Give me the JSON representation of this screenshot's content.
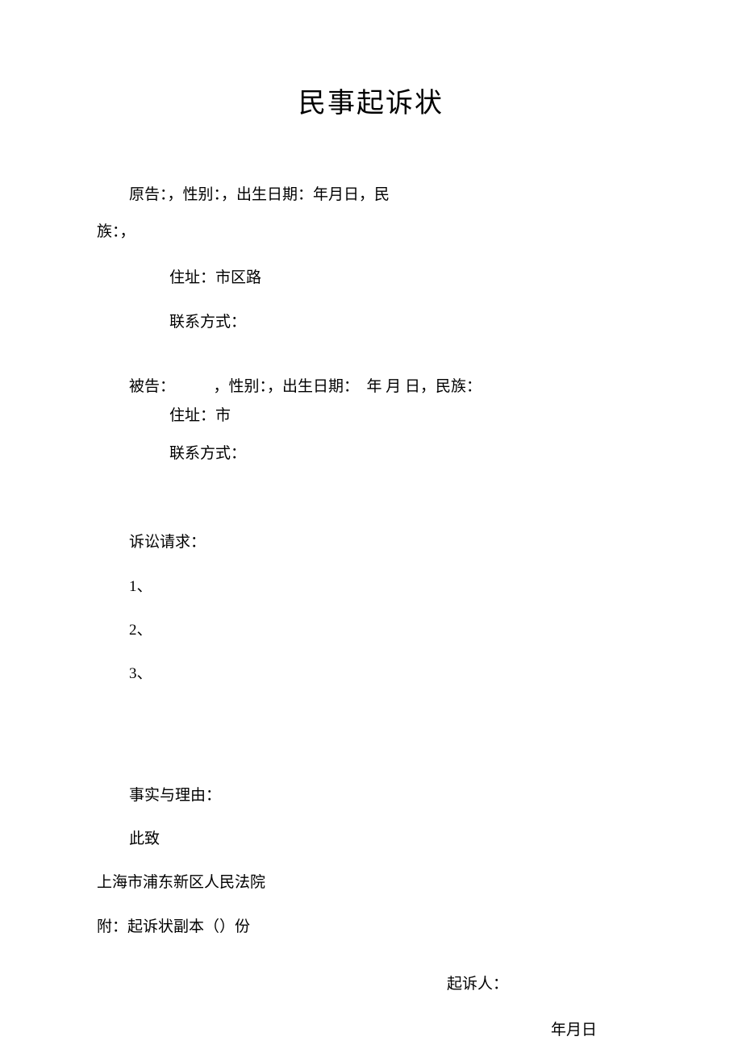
{
  "title": "民事起诉状",
  "plaintiff": {
    "line1_part1": "原告：，性别：，出生日期：年月日，民",
    "line1_part2": "族：，",
    "address": "住址：市区路",
    "contact": "联系方式："
  },
  "defendant": {
    "line1": "被告：　　　，性别：，出生日期：　年 月 日，民族：",
    "address": "住址：市",
    "contact": "联系方式："
  },
  "claims": {
    "heading": "诉讼请求：",
    "item1": "1、",
    "item2": "2、",
    "item3": "3、"
  },
  "facts": {
    "heading": "事实与理由：",
    "closing": "此致"
  },
  "court": "上海市浦东新区人民法院",
  "attachment": "附：起诉状副本（）份",
  "signature_label": "起诉人：",
  "date": "年月日"
}
